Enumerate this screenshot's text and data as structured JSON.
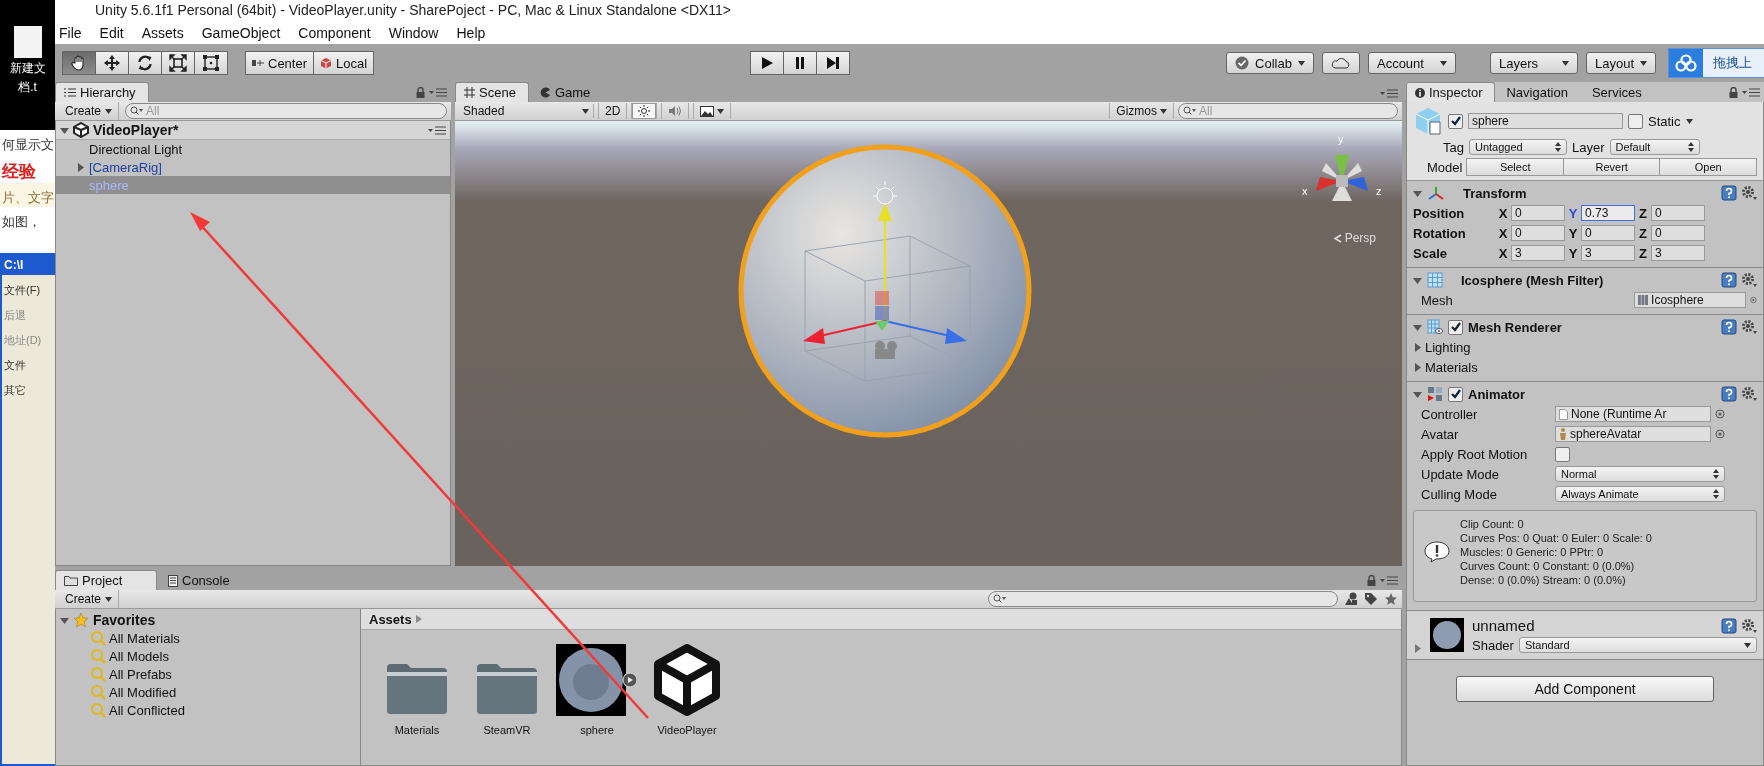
{
  "desktop": {
    "file_label": [
      "新建文",
      "档.t"
    ],
    "page_texts": [
      "何显示文",
      "经验",
      "片、文字",
      "如图，"
    ],
    "explorer": {
      "title": "C:\\I",
      "menu": "文件(F)",
      "back": "后退",
      "address": "地址(D)",
      "sections": [
        "文件",
        "其它"
      ]
    }
  },
  "window": {
    "title": "Unity 5.6.1f1 Personal (64bit) - VideoPlayer.unity - SharePoject - PC, Mac & Linux Standalone <DX11>"
  },
  "menu_bar": [
    "File",
    "Edit",
    "Assets",
    "GameObject",
    "Component",
    "Window",
    "Help"
  ],
  "toolbar": {
    "tools": [
      {
        "kind": "hand",
        "selected": true
      },
      {
        "kind": "move",
        "selected": false
      },
      {
        "kind": "rotate",
        "selected": false
      },
      {
        "kind": "scale",
        "selected": false
      },
      {
        "kind": "rect",
        "selected": false
      }
    ],
    "pivot": [
      {
        "kind": "center",
        "label": "Center"
      },
      {
        "kind": "local",
        "label": "Local"
      }
    ],
    "playback": [
      {
        "kind": "play"
      },
      {
        "kind": "pause"
      },
      {
        "kind": "step"
      }
    ],
    "collab": "Collab",
    "account": "Account",
    "layers": "Layers",
    "layout": "Layout"
  },
  "upload_popup": {
    "label": "拖拽上"
  },
  "hierarchy": {
    "tab": "Hierarchy",
    "create": "Create",
    "search_placeholder": "All",
    "scene": "VideoPlayer*",
    "items": [
      {
        "label": "Directional Light",
        "kind": "object",
        "expandable": false,
        "selected": false
      },
      {
        "label": "[CameraRig]",
        "kind": "prefab",
        "expandable": true,
        "selected": false
      },
      {
        "label": "sphere",
        "kind": "prefab",
        "expandable": false,
        "selected": true
      }
    ]
  },
  "scene_view": {
    "tabs": [
      {
        "label": "Scene",
        "kind": "scene",
        "selected": true
      },
      {
        "label": "Game",
        "kind": "game",
        "selected": false
      }
    ],
    "shading": "Shaded",
    "mode_2d": "2D",
    "lighting_on": true,
    "audio_on": false,
    "gizmos": "Gizmos",
    "search_placeholder": "All",
    "axis_labels": [
      "y",
      "x",
      "z"
    ],
    "projection": "Persp"
  },
  "inspector": {
    "tabs": [
      {
        "label": "Inspector",
        "selected": true
      },
      {
        "label": "Navigation",
        "selected": false
      },
      {
        "label": "Services",
        "selected": false
      }
    ],
    "object": {
      "active": true,
      "name": "sphere",
      "static_label": "Static",
      "static": false,
      "tag_label": "Tag",
      "tag": "Untagged",
      "layer_label": "Layer",
      "layer": "Default",
      "model_label": "Model",
      "model_buttons": [
        "Select",
        "Revert",
        "Open"
      ]
    },
    "components": [
      {
        "kind": "transform",
        "title": "Transform",
        "rows": [
          {
            "label": "Position",
            "fields": [
              {
                "axis": "X",
                "value": "0",
                "focused": false
              },
              {
                "axis": "Y",
                "value": "0.73",
                "focused": true
              },
              {
                "axis": "Z",
                "value": "0",
                "focused": false
              }
            ]
          },
          {
            "label": "Rotation",
            "fields": [
              {
                "axis": "X",
                "value": "0",
                "focused": false
              },
              {
                "axis": "Y",
                "value": "0",
                "focused": false
              },
              {
                "axis": "Z",
                "value": "0",
                "focused": false
              }
            ]
          },
          {
            "label": "Scale",
            "fields": [
              {
                "axis": "X",
                "value": "3",
                "focused": false
              },
              {
                "axis": "Y",
                "value": "3",
                "focused": false
              },
              {
                "axis": "Z",
                "value": "3",
                "focused": false
              }
            ]
          }
        ]
      },
      {
        "kind": "mesh_filter",
        "title": "Icosphere (Mesh Filter)",
        "props": [
          {
            "kind": "mesh_field",
            "label": "Mesh",
            "value": "Icosphere"
          }
        ]
      },
      {
        "kind": "mesh_renderer",
        "title": "Mesh Renderer",
        "enabled": true,
        "props": [
          {
            "kind": "foldout",
            "label": "Lighting"
          },
          {
            "kind": "foldout",
            "label": "Materials"
          }
        ]
      },
      {
        "kind": "animator",
        "title": "Animator",
        "enabled": true,
        "props": [
          {
            "kind": "file_field",
            "label": "Controller",
            "value": "None (Runtime Ar"
          },
          {
            "kind": "avatar_field",
            "label": "Avatar",
            "value": "sphereAvatar"
          },
          {
            "kind": "toggle",
            "label": "Apply Root Motion",
            "checked": false
          },
          {
            "kind": "dropdown",
            "label": "Update Mode",
            "value": "Normal"
          },
          {
            "kind": "dropdown",
            "label": "Culling Mode",
            "value": "Always Animate"
          }
        ],
        "info": [
          "Clip Count: 0",
          "Curves Pos: 0 Quat: 0 Euler: 0 Scale: 0",
          "Muscles: 0 Generic: 0 PPtr: 0",
          "Curves Count: 0 Constant: 0 (0.0%)",
          "Dense: 0 (0.0%) Stream: 0 (0.0%)"
        ]
      }
    ],
    "material": {
      "name": "unnamed",
      "shader_label": "Shader",
      "shader": "Standard"
    },
    "add_component": "Add Component"
  },
  "project": {
    "tabs": [
      {
        "label": "Project",
        "kind": "project",
        "selected": true
      },
      {
        "label": "Console",
        "kind": "console",
        "selected": false
      }
    ],
    "create": "Create",
    "favorites": {
      "label": "Favorites",
      "items": [
        "All Materials",
        "All Models",
        "All Prefabs",
        "All Modified",
        "All Conflicted"
      ]
    },
    "breadcrumb": "Assets",
    "assets": [
      {
        "label": "Materials",
        "kind": "folder"
      },
      {
        "label": "SteamVR",
        "kind": "folder"
      },
      {
        "label": "sphere",
        "kind": "model"
      },
      {
        "label": "VideoPlayer",
        "kind": "scene"
      }
    ]
  }
}
